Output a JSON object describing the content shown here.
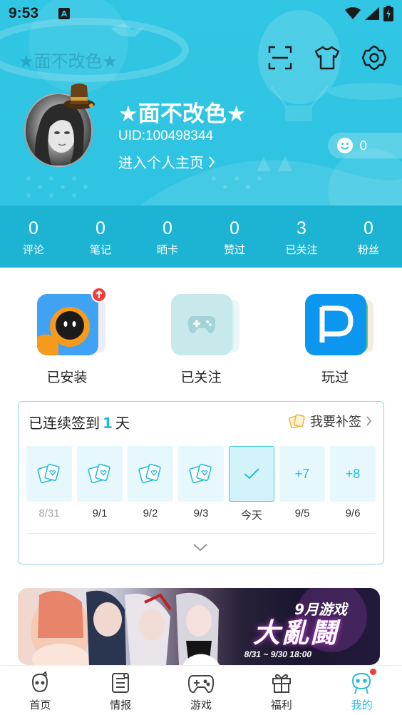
{
  "status_bar": {
    "time": "9:53",
    "notification_icon": "A"
  },
  "header": {
    "faded_title": "★面不改色★",
    "nickname": "★面不改色★",
    "uid": "UID:100498344",
    "homepage_link": "进入个人主页",
    "smile_count": "0",
    "stats": [
      {
        "value": "0",
        "label": "评论"
      },
      {
        "value": "0",
        "label": "笔记"
      },
      {
        "value": "0",
        "label": "晒卡"
      },
      {
        "value": "0",
        "label": "赞过"
      },
      {
        "value": "3",
        "label": "已关注"
      },
      {
        "value": "0",
        "label": "粉丝"
      }
    ],
    "colors": {
      "background": "#31c6e3",
      "band": "#1db4d4"
    }
  },
  "games": [
    {
      "label": "已安装",
      "has_update": true
    },
    {
      "label": "已关注"
    },
    {
      "label": "玩过"
    }
  ],
  "checkin": {
    "title_prefix": "已连续签到",
    "streak": "1",
    "title_suffix": "天",
    "makeup_label": "我要补签",
    "days": [
      {
        "box": "",
        "label": "8/31"
      },
      {
        "box": "",
        "label": "9/1"
      },
      {
        "box": "",
        "label": "9/2"
      },
      {
        "box": "",
        "label": "9/3"
      },
      {
        "box": "",
        "label": "今天"
      },
      {
        "box": "+7",
        "label": "9/5"
      },
      {
        "box": "+8",
        "label": "9/6"
      }
    ],
    "accent_color": "#21b9d8"
  },
  "banner": {
    "tag": "9月游戏",
    "main": "大亂鬪",
    "date": "8/31 ~ 9/30  18:00"
  },
  "bottom_nav": [
    {
      "label": "首页",
      "icon": "home-mascot-icon"
    },
    {
      "label": "情报",
      "icon": "news-icon"
    },
    {
      "label": "游戏",
      "icon": "gamepad-icon"
    },
    {
      "label": "福利",
      "icon": "gift-icon"
    },
    {
      "label": "我的",
      "icon": "profile-mascot-icon",
      "active": true
    }
  ]
}
